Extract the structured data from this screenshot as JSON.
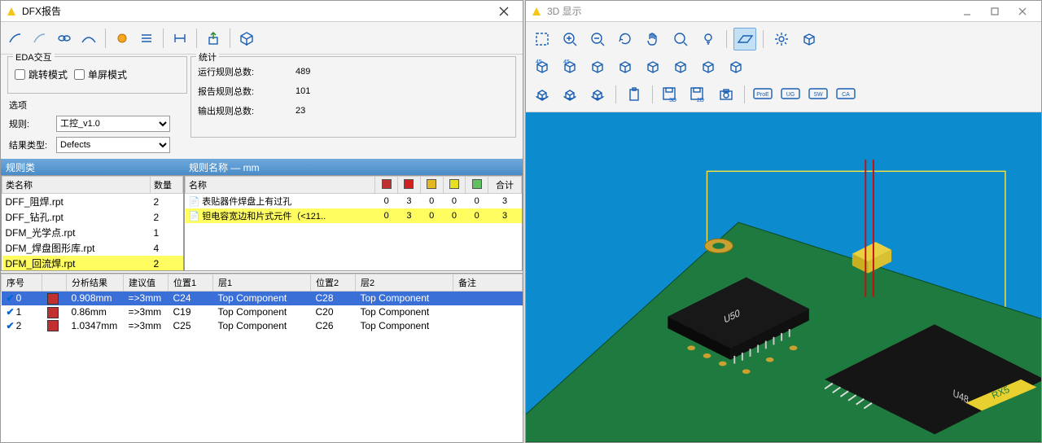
{
  "left": {
    "title": "DFX报告",
    "eda_group": "EDA交互",
    "eda_chk1": "跳转模式",
    "eda_chk2": "单屏模式",
    "opt_group": "选项",
    "opt_rule_label": "规则:",
    "opt_rule_value": "工控_v1.0",
    "opt_type_label": "结果类型:",
    "opt_type_value": "Defects",
    "stat_group": "统计",
    "stat1_label": "运行规则总数:",
    "stat1_val": "489",
    "stat2_label": "报告规则总数:",
    "stat2_val": "101",
    "stat3_label": "输出规则总数:",
    "stat3_val": "23",
    "rule_class_hdr": "规则类",
    "rule_class_cols": {
      "name": "类名称",
      "qty": "数量"
    },
    "rule_classes": [
      {
        "name": "DFF_阻焊.rpt",
        "qty": "2",
        "sel": false
      },
      {
        "name": "DFF_钻孔.rpt",
        "qty": "2",
        "sel": false
      },
      {
        "name": "DFM_光学点.rpt",
        "qty": "1",
        "sel": false
      },
      {
        "name": "DFM_焊盘图形库.rpt",
        "qty": "4",
        "sel": false
      },
      {
        "name": "DFM_回流焊.rpt",
        "qty": "2",
        "sel": true
      }
    ],
    "rule_name_hdr": "规则名称 — mm",
    "rule_name_cols": {
      "name": "名称",
      "total": "合计"
    },
    "colors": [
      "#c03030",
      "#d02020",
      "#e6b820",
      "#e6e020",
      "#60c060"
    ],
    "rule_names": [
      {
        "name": "表贴器件焊盘上有过孔",
        "vals": [
          "0",
          "3",
          "0",
          "0",
          "0",
          "3"
        ],
        "sel": false
      },
      {
        "name": "钽电容宽边和片式元件（<121..",
        "vals": [
          "0",
          "3",
          "0",
          "0",
          "0",
          "3"
        ],
        "sel": true
      }
    ],
    "detail_cols": {
      "idx": "序号",
      "result": "分析结果",
      "suggest": "建议值",
      "pos1": "位置1",
      "layer1": "层1",
      "pos2": "位置2",
      "layer2": "层2",
      "remark": "备注"
    },
    "details": [
      {
        "idx": "0",
        "sw": "#c03030",
        "result": "0.908mm",
        "suggest": "=>3mm",
        "pos1": "C24",
        "layer1": "Top Component",
        "pos2": "C28",
        "layer2": "Top Component",
        "hilite": true
      },
      {
        "idx": "1",
        "sw": "#c03030",
        "result": "0.86mm",
        "suggest": "=>3mm",
        "pos1": "C19",
        "layer1": "Top Component",
        "pos2": "C20",
        "layer2": "Top Component",
        "hilite": false
      },
      {
        "idx": "2",
        "sw": "#c03030",
        "result": "1.0347mm",
        "suggest": "=>3mm",
        "pos1": "C25",
        "layer1": "Top Component",
        "pos2": "C26",
        "layer2": "Top Component",
        "hilite": false
      }
    ]
  },
  "right": {
    "title": "3D 显示",
    "row3_labels": [
      "3D",
      "2D",
      "",
      "ProE",
      "UG",
      "SW",
      "CA"
    ]
  }
}
